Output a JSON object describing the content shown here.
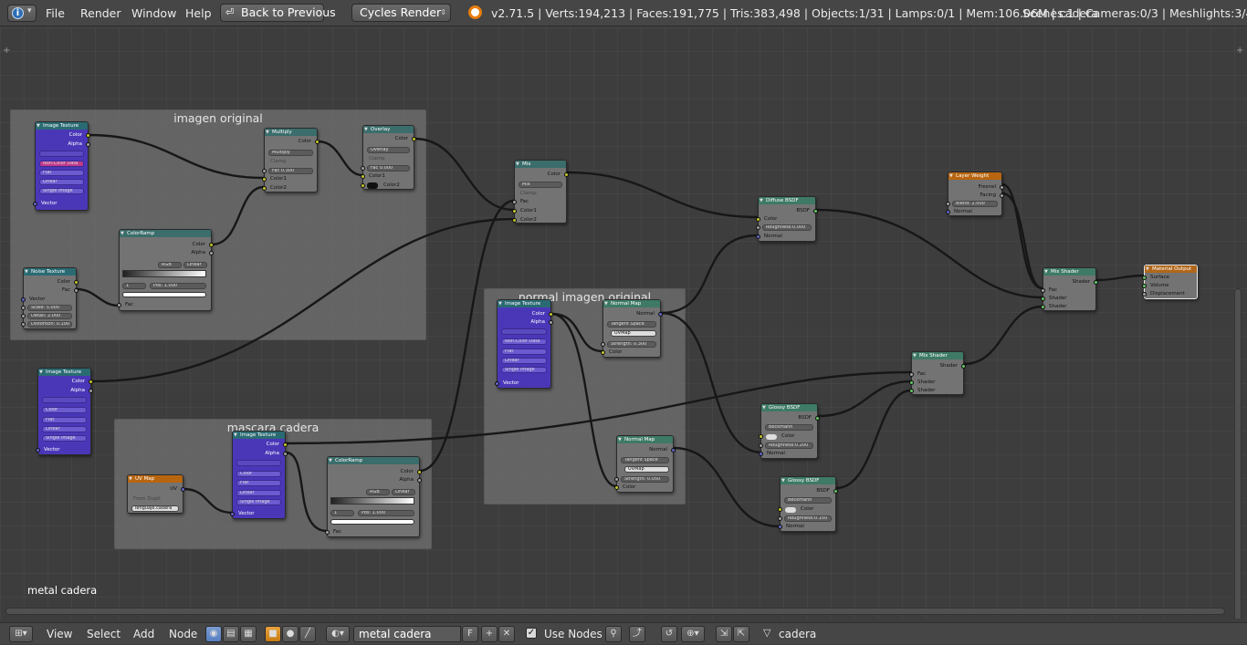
{
  "topbar": {
    "menus": [
      "File",
      "Render",
      "Window",
      "Help"
    ],
    "back_button": "Back to Previous",
    "engine": "Cycles Render",
    "stats": "v2.71.5 | Verts:194,213 | Faces:191,775 | Tris:383,498 | Objects:1/31 | Lamps:0/1 | Mem:106.06M | cadera",
    "scenes": "Scenes:1 | Cameras:0/3 | Meshlights:3/4"
  },
  "frames": {
    "imagen": "imagen original",
    "normal": "normal imagen original",
    "mascara": "mascara cadera"
  },
  "nodes": {
    "img1": {
      "title": "Image Texture",
      "out_color": "Color",
      "out_alpha": "Alpha",
      "w1": "Non-Color Data",
      "w2": "Flat",
      "w3": "Linear",
      "w4": "Single Image",
      "in_vector": "Vector"
    },
    "multiply": {
      "title": "Multiply",
      "out": "Color",
      "mode": "Multiply",
      "clamp": "Clamp",
      "fac": "Fac",
      "fac_val": "0.300",
      "c1": "Color1",
      "c2": "Color2"
    },
    "overlay": {
      "title": "Overlay",
      "out": "Color",
      "mode": "Overlay",
      "clamp": "Clamp",
      "fac": "Fac",
      "fac_val": "0.000",
      "c1": "Color1",
      "c2": "Color2"
    },
    "ramp1": {
      "title": "ColorRamp",
      "out_color": "Color",
      "out_alpha": "Alpha",
      "mode": "RGB",
      "interp": "Linear",
      "idx": "1",
      "pos": "Pos:",
      "pos_val": "1.000",
      "fac": "Fac"
    },
    "noise": {
      "title": "Noise Texture",
      "out_color": "Color",
      "out_fac": "Fac",
      "vector": "Vector",
      "scale": "Scale:",
      "scale_val": "5.000",
      "detail": "Detail:",
      "detail_val": "2.000",
      "dist": "Distortion:",
      "dist_val": "0.100"
    },
    "img2": {
      "title": "Image Texture",
      "out_color": "Color",
      "out_alpha": "Alpha",
      "w1": "Color",
      "w2": "Flat",
      "w3": "Linear",
      "w4": "Single Image",
      "in_vector": "Vector"
    },
    "mix": {
      "title": "Mix",
      "out": "Color",
      "mode": "Mix",
      "clamp": "Clamp",
      "fac": "Fac",
      "c1": "Color1",
      "c2": "Color2"
    },
    "img3": {
      "title": "Image Texture",
      "out_color": "Color",
      "out_alpha": "Alpha",
      "w1": "Non-Color Data",
      "w2": "Flat",
      "w3": "Linear",
      "w4": "Single Image",
      "in_vector": "Vector"
    },
    "nmap1": {
      "title": "Normal Map",
      "out": "Normal",
      "space": "Tangent Space",
      "uv": "UVMap",
      "strength": "Strength:",
      "strength_val": "0.300",
      "color": "Color"
    },
    "nmap2": {
      "title": "Normal Map",
      "out": "Normal",
      "space": "Tangent Space",
      "uv": "UVMap",
      "strength": "Strength:",
      "strength_val": "0.050",
      "color": "Color"
    },
    "img4": {
      "title": "Image Texture",
      "out_color": "Color",
      "out_alpha": "Alpha",
      "w1": "Color",
      "w2": "Flat",
      "w3": "Linear",
      "w4": "Single Image",
      "in_vector": "Vector"
    },
    "uvmap": {
      "title": "UV Map",
      "out": "UV",
      "from_dupli": "From Dupli",
      "map": "lenguaje.cadera"
    },
    "ramp2": {
      "title": "ColorRamp",
      "out_color": "Color",
      "out_alpha": "Alpha",
      "mode": "RGB",
      "interp": "Linear",
      "idx": "1",
      "pos": "Pos:",
      "pos_val": "1.000",
      "fac": "Fac"
    },
    "diffuse": {
      "title": "Diffuse BSDF",
      "out": "BSDF",
      "color": "Color",
      "rough": "Roughness:",
      "rough_val": "0.000",
      "normal": "Normal"
    },
    "layer": {
      "title": "Layer Weight",
      "fresnel": "Fresnel",
      "facing": "Facing",
      "blend": "Blend:",
      "blend_val": "2.000",
      "normal": "Normal"
    },
    "mix1": {
      "title": "Mix Shader",
      "out": "Shader",
      "fac": "Fac",
      "s1": "Shader",
      "s2": "Shader"
    },
    "output": {
      "title": "Material Output",
      "surface": "Surface",
      "volume": "Volume",
      "disp": "Displacement"
    },
    "mix2": {
      "title": "Mix Shader",
      "out": "Shader",
      "fac": "Fac",
      "s1": "Shader",
      "s2": "Shader"
    },
    "glossy1": {
      "title": "Glossy BSDF",
      "out": "BSDF",
      "dist": "Beckmann",
      "color": "Color",
      "rough": "Roughness:",
      "rough_val": "0.200",
      "normal": "Normal"
    },
    "glossy2": {
      "title": "Glossy BSDF",
      "out": "BSDF",
      "dist": "Beckmann",
      "color": "Color",
      "rough": "Roughness:",
      "rough_val": "0.150",
      "normal": "Normal"
    }
  },
  "material_label": "metal cadera",
  "bottombar": {
    "menus": [
      "View",
      "Select",
      "Add",
      "Node"
    ],
    "material": "metal cadera",
    "fake_user": "F",
    "use_nodes": "Use Nodes",
    "object": "cadera"
  },
  "colors": {
    "header_bg": "#464646",
    "editor_bg": "#3d3d3d",
    "frame_bg": "#707070",
    "image_node": "#4a37b8",
    "wire": "#1a1a1a"
  }
}
